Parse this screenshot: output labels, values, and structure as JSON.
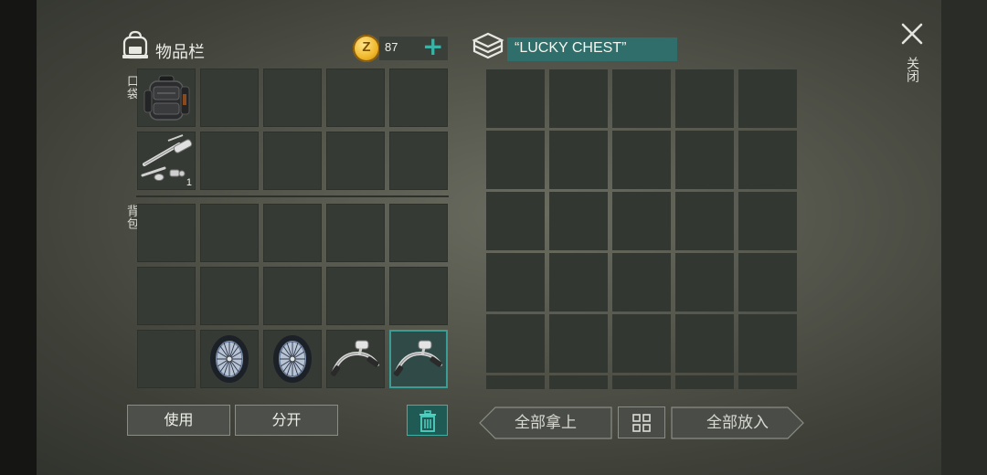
{
  "inventory": {
    "title": "物品栏",
    "pocket_label": "口袋",
    "backpack_label": "背包",
    "coins": "87",
    "pocket_items": [
      {
        "icon": "backpack-item-icon",
        "qty": ""
      },
      {
        "icon": "rod-parts-item-icon",
        "qty": "1"
      }
    ],
    "backpack_items": [
      {
        "slot": 11,
        "icon": "bicycle-wheel-icon"
      },
      {
        "slot": 12,
        "icon": "bicycle-wheel-icon"
      },
      {
        "slot": 13,
        "icon": "bicycle-handlebar-icon"
      },
      {
        "slot": 14,
        "icon": "bicycle-handlebar-icon",
        "selected": true
      }
    ]
  },
  "chest": {
    "name": "“LUCKY CHEST”"
  },
  "buttons": {
    "use": "使用",
    "split": "分开",
    "take_all": "全部拿上",
    "put_all": "全部放入"
  },
  "close": {
    "label": "关闭"
  },
  "colors": {
    "accent": "#39b3a5",
    "chest_name_bg": "#2f6e6a",
    "selected_slot": "#2f4a47",
    "coin": "#f0b72a"
  }
}
